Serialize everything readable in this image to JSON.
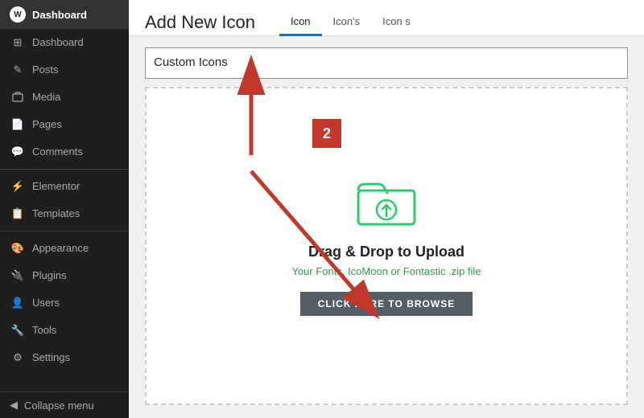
{
  "sidebar": {
    "logo_label": "Dashboard",
    "items": [
      {
        "id": "dashboard",
        "label": "Dashboard",
        "icon": "⊞"
      },
      {
        "id": "posts",
        "label": "Posts",
        "icon": "✎"
      },
      {
        "id": "media",
        "label": "Media",
        "icon": "🖼"
      },
      {
        "id": "pages",
        "label": "Pages",
        "icon": "📄"
      },
      {
        "id": "comments",
        "label": "Comments",
        "icon": "💬"
      },
      {
        "id": "elementor",
        "label": "Elementor",
        "icon": "⚡"
      },
      {
        "id": "templates",
        "label": "Templates",
        "icon": "📋"
      },
      {
        "id": "appearance",
        "label": "Appearance",
        "icon": "🎨"
      },
      {
        "id": "plugins",
        "label": "Plugins",
        "icon": "🔌"
      },
      {
        "id": "users",
        "label": "Users",
        "icon": "👤"
      },
      {
        "id": "tools",
        "label": "Tools",
        "icon": "🔧"
      },
      {
        "id": "settings",
        "label": "Settings",
        "icon": "⚙"
      }
    ],
    "collapse_label": "Collapse menu"
  },
  "header": {
    "title": "Add New Icon",
    "tabs": [
      {
        "id": "icon",
        "label": "Icon",
        "active": true
      },
      {
        "id": "icons",
        "label": "Icon's"
      },
      {
        "id": "icons2",
        "label": "Icon s"
      }
    ]
  },
  "input": {
    "value": "Custom Icons",
    "placeholder": "Custom Icons"
  },
  "upload": {
    "drag_drop_title": "Drag & Drop to Upload",
    "drag_drop_subtitle": "Your Fonts, IcoMoon or Fontastic .zip file",
    "browse_label": "CLICK HERE TO BROWSE"
  },
  "annotation": {
    "step_number": "2"
  }
}
